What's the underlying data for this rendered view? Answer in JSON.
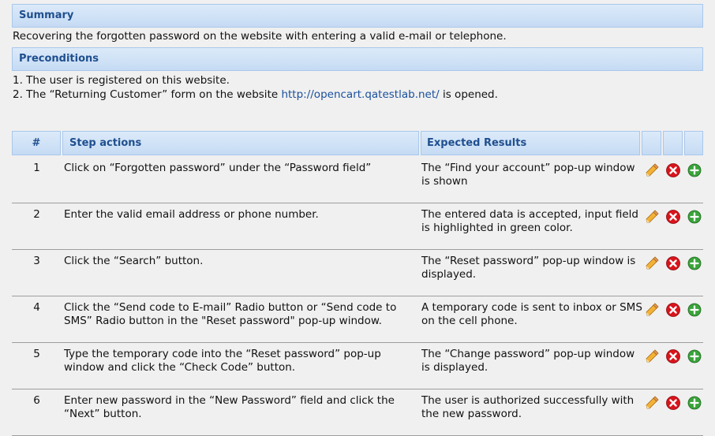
{
  "summary": {
    "header": "Summary",
    "text": "Recovering the forgotten password on the website with entering a valid e-mail or telephone."
  },
  "preconditions": {
    "header": "Preconditions",
    "line1": "1. The user is registered on this website.",
    "line2_before": "2. The “Returning Customer” form on  the website ",
    "line2_link": "http://opencart.qatestlab.net/",
    "line2_after": " is opened."
  },
  "table": {
    "headers": {
      "num": "#",
      "step": "Step actions",
      "expected": "Expected Results"
    },
    "rows": [
      {
        "num": "1",
        "step": "Click on “Forgotten password” under the “Password field”",
        "expected": "The “Find your account” pop-up window is shown"
      },
      {
        "num": "2",
        "step": "Enter the valid email address or phone number.",
        "expected": "The entered data is accepted, input field is highlighted in green color."
      },
      {
        "num": "3",
        "step": "Click the “Search” button.",
        "expected": "The “Reset password” pop-up window is displayed."
      },
      {
        "num": "4",
        "step": "Click the “Send code to E-mail” Radio button or “Send code to SMS” Radio button in the \"Reset password\" pop-up window.",
        "expected": "A temporary code is sent to inbox or SMS on the cell phone."
      },
      {
        "num": "5",
        "step": "Type the temporary code into the “Reset password” pop-up window and click the “Check Code” button.",
        "expected": "The “Change password” pop-up window is displayed."
      },
      {
        "num": "6",
        "step": "Enter new password in the “New Password” field and click the “Next” button.",
        "expected": "The user is authorized successfully with the new password."
      }
    ]
  },
  "icons": {
    "edit": "pencil-icon",
    "delete": "delete-icon",
    "add": "add-icon"
  },
  "colors": {
    "header_text": "#1f4f8f",
    "link": "#1a4f9c",
    "delete": "#d8141c",
    "add": "#3aa43a"
  }
}
